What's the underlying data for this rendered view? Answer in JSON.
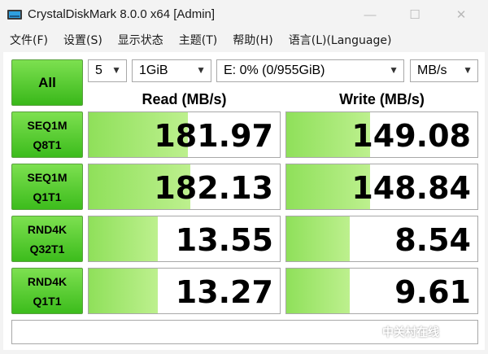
{
  "window": {
    "title": "CrystalDiskMark 8.0.0 x64 [Admin]",
    "minimize": "—",
    "maximize": "☐",
    "close": "✕"
  },
  "menu": [
    {
      "label": "文件(F)"
    },
    {
      "label": "设置(S)"
    },
    {
      "label": "显示状态"
    },
    {
      "label": "主题(T)"
    },
    {
      "label": "帮助(H)"
    },
    {
      "label": "语言(L)(Language)"
    }
  ],
  "controls": {
    "all_label": "All",
    "count": "5",
    "size": "1GiB",
    "drive": "E: 0% (0/955GiB)",
    "unit": "MB/s"
  },
  "headers": {
    "read": "Read (MB/s)",
    "write": "Write (MB/s)"
  },
  "rows": [
    {
      "line1": "SEQ1M",
      "line2": "Q8T1",
      "read": "181.97",
      "write": "149.08",
      "read_fill": 0.52,
      "write_fill": 0.44
    },
    {
      "line1": "SEQ1M",
      "line2": "Q1T1",
      "read": "182.13",
      "write": "148.84",
      "read_fill": 0.53,
      "write_fill": 0.44
    },
    {
      "line1": "RND4K",
      "line2": "Q32T1",
      "read": "13.55",
      "write": "8.54",
      "read_fill": 0.36,
      "write_fill": 0.33
    },
    {
      "line1": "RND4K",
      "line2": "Q1T1",
      "read": "13.27",
      "write": "9.61",
      "read_fill": 0.36,
      "write_fill": 0.33
    }
  ],
  "watermark": "中关村在线",
  "colors": {
    "accent_green": "#3cbc1c",
    "bar_green": "#8fe05a"
  }
}
